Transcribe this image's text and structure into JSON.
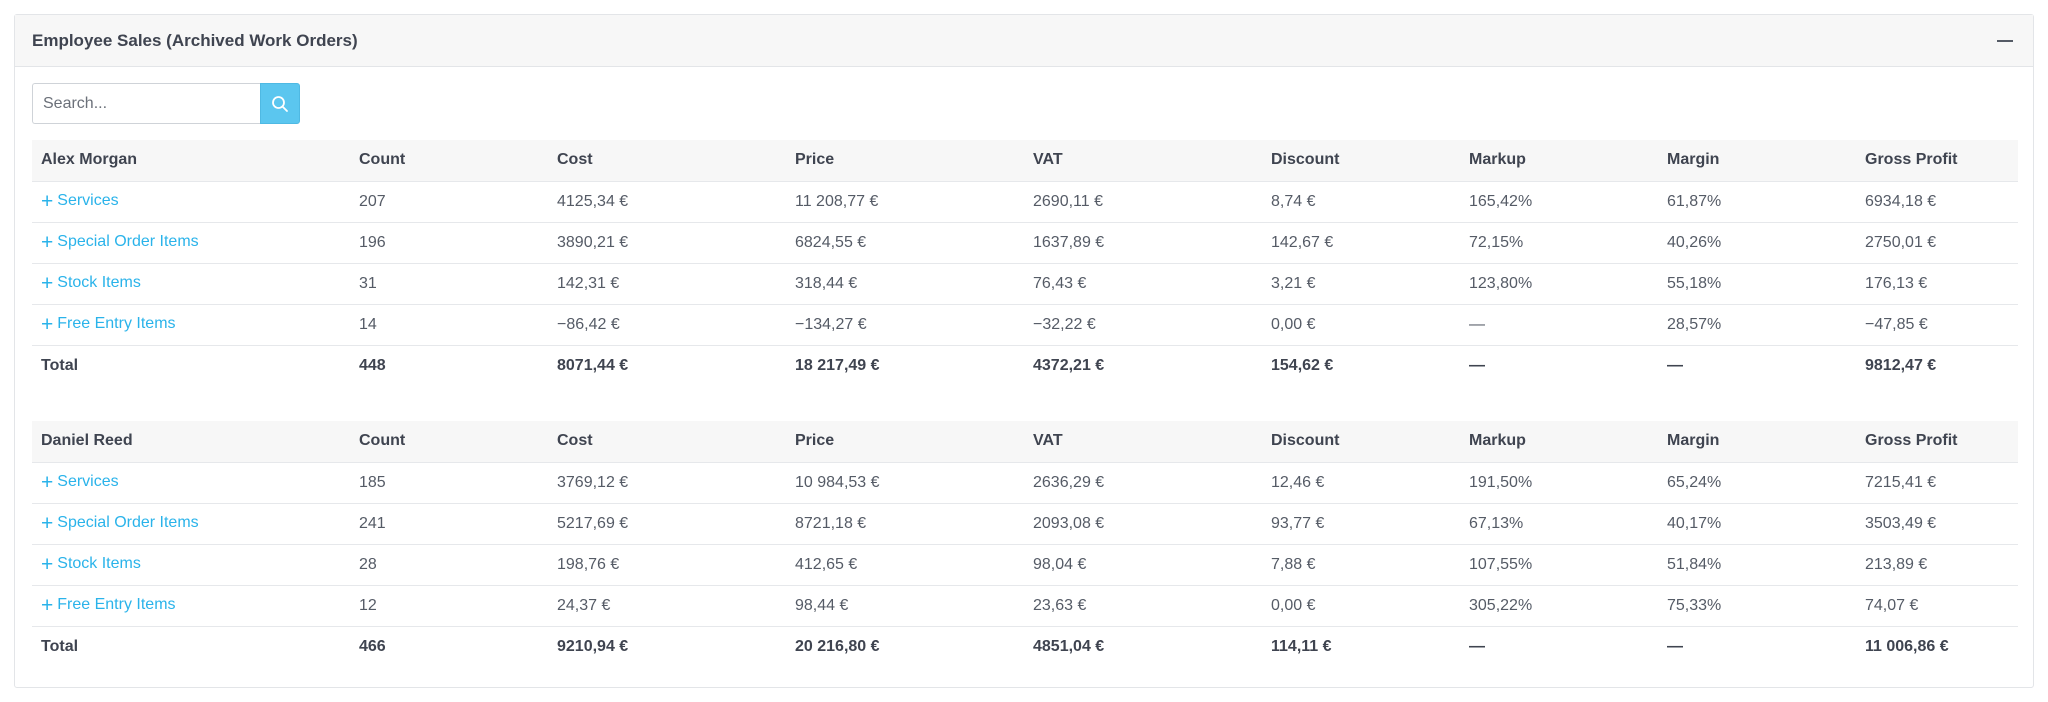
{
  "panel": {
    "title": "Employee Sales (Archived Work Orders)"
  },
  "search": {
    "placeholder": "Search...",
    "value": ""
  },
  "columns": [
    "Count",
    "Cost",
    "Price",
    "VAT",
    "Discount",
    "Markup",
    "Margin",
    "Gross Profit"
  ],
  "employees": [
    {
      "name": "Alex Morgan",
      "rows": [
        {
          "label": "Services",
          "count": "207",
          "cost": "4125,34 €",
          "price": "11 208,77 €",
          "vat": "2690,11 €",
          "discount": "8,74 €",
          "markup": "165,42%",
          "margin": "61,87%",
          "gross_profit": "6934,18 €"
        },
        {
          "label": "Special Order Items",
          "count": "196",
          "cost": "3890,21 €",
          "price": "6824,55 €",
          "vat": "1637,89 €",
          "discount": "142,67 €",
          "markup": "72,15%",
          "margin": "40,26%",
          "gross_profit": "2750,01 €"
        },
        {
          "label": "Stock Items",
          "count": "31",
          "cost": "142,31 €",
          "price": "318,44 €",
          "vat": "76,43 €",
          "discount": "3,21 €",
          "markup": "123,80%",
          "margin": "55,18%",
          "gross_profit": "176,13 €"
        },
        {
          "label": "Free Entry Items",
          "count": "14",
          "cost": "−86,42 €",
          "price": "−134,27 €",
          "vat": "−32,22 €",
          "discount": "0,00 €",
          "markup": "—",
          "margin": "28,57%",
          "gross_profit": "−47,85 €"
        }
      ],
      "total": {
        "label": "Total",
        "count": "448",
        "cost": "8071,44 €",
        "price": "18 217,49 €",
        "vat": "4372,21 €",
        "discount": "154,62 €",
        "markup": "—",
        "margin": "—",
        "gross_profit": "9812,47 €"
      }
    },
    {
      "name": "Daniel Reed",
      "rows": [
        {
          "label": "Services",
          "count": "185",
          "cost": "3769,12 €",
          "price": "10 984,53 €",
          "vat": "2636,29 €",
          "discount": "12,46 €",
          "markup": "191,50%",
          "margin": "65,24%",
          "gross_profit": "7215,41 €"
        },
        {
          "label": "Special Order Items",
          "count": "241",
          "cost": "5217,69 €",
          "price": "8721,18 €",
          "vat": "2093,08 €",
          "discount": "93,77 €",
          "markup": "67,13%",
          "margin": "40,17%",
          "gross_profit": "3503,49 €"
        },
        {
          "label": "Stock Items",
          "count": "28",
          "cost": "198,76 €",
          "price": "412,65 €",
          "vat": "98,04 €",
          "discount": "7,88 €",
          "markup": "107,55%",
          "margin": "51,84%",
          "gross_profit": "213,89 €"
        },
        {
          "label": "Free Entry Items",
          "count": "12",
          "cost": "24,37 €",
          "price": "98,44 €",
          "vat": "23,63 €",
          "discount": "0,00 €",
          "markup": "305,22%",
          "margin": "75,33%",
          "gross_profit": "74,07 €"
        }
      ],
      "total": {
        "label": "Total",
        "count": "466",
        "cost": "9210,94 €",
        "price": "20 216,80 €",
        "vat": "4851,04 €",
        "discount": "114,11 €",
        "markup": "—",
        "margin": "—",
        "gross_profit": "11 006,86 €"
      }
    }
  ]
}
